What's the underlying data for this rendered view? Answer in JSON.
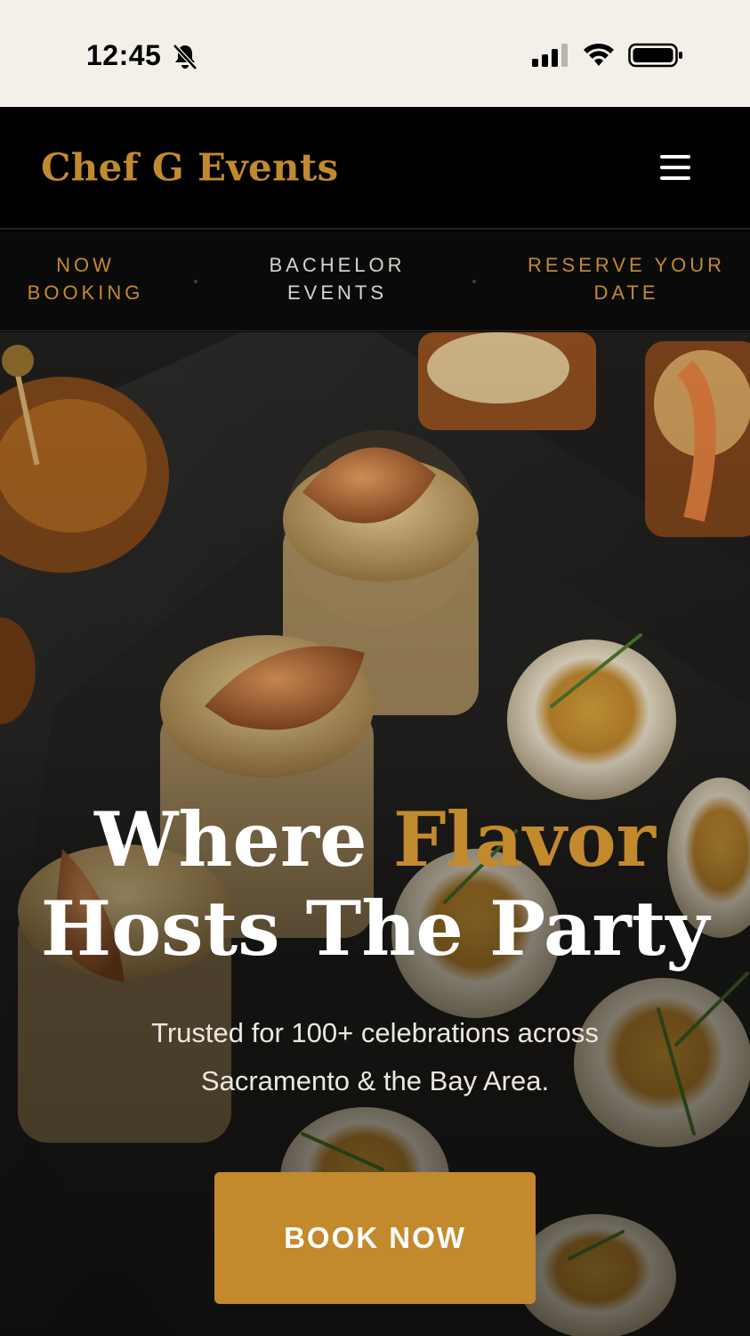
{
  "status_bar": {
    "time": "12:45",
    "icons": [
      "bell-slash-icon",
      "signal-icon",
      "wifi-icon",
      "battery-icon"
    ]
  },
  "header": {
    "brand": "Chef G Events",
    "menu_icon": "hamburger-menu-icon"
  },
  "ticker": {
    "items": [
      {
        "line1": "NOW",
        "line2": "BOOKING"
      },
      {
        "line1": "BACHELOR",
        "line2": "EVENTS"
      },
      {
        "line1": "RESERVE YOUR",
        "line2": "DATE"
      }
    ]
  },
  "hero": {
    "title_part1": "Where ",
    "title_accent": "Flavor",
    "title_line2": "Hosts The Party",
    "subtitle": "Trusted for 100+ celebrations across Sacramento & the Bay Area.",
    "cta": "BOOK NOW"
  },
  "colors": {
    "accent": "#c28a2c",
    "header_bg": "#000000",
    "status_bg": "#f3f0ea"
  }
}
